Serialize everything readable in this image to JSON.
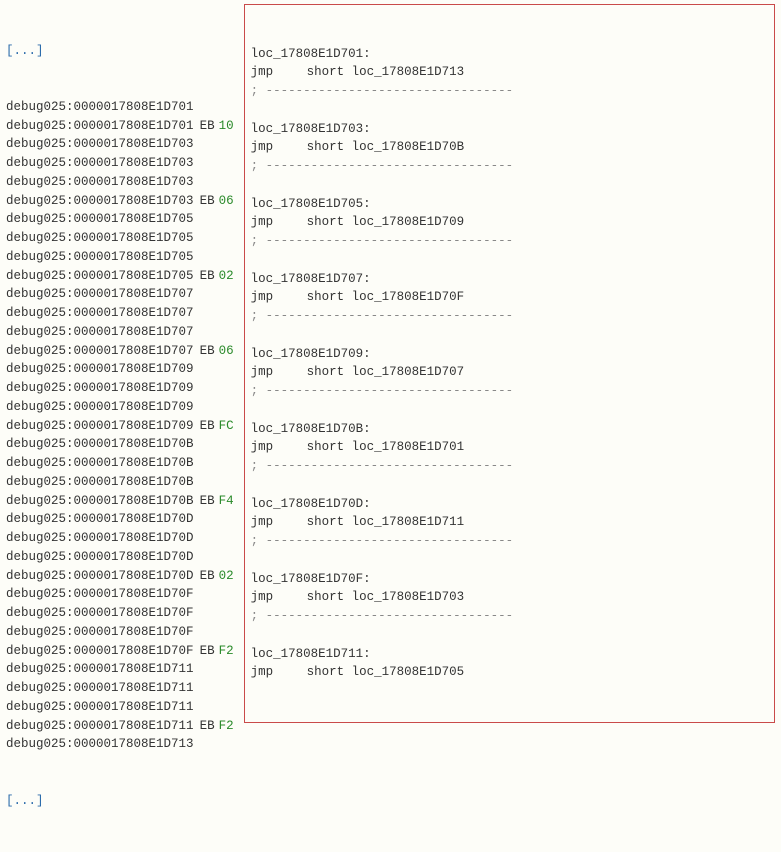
{
  "ellipsis_top": "[...]",
  "ellipsis_bottom": "[...]",
  "segment": "debug025",
  "left_lines": [
    {
      "addr": "0000017808E1D701",
      "bytes": []
    },
    {
      "addr": "0000017808E1D701",
      "bytes": [
        "EB",
        "10"
      ]
    },
    {
      "addr": "0000017808E1D703",
      "bytes": []
    },
    {
      "addr": "0000017808E1D703",
      "bytes": []
    },
    {
      "addr": "0000017808E1D703",
      "bytes": []
    },
    {
      "addr": "0000017808E1D703",
      "bytes": [
        "EB",
        "06"
      ]
    },
    {
      "addr": "0000017808E1D705",
      "bytes": []
    },
    {
      "addr": "0000017808E1D705",
      "bytes": []
    },
    {
      "addr": "0000017808E1D705",
      "bytes": []
    },
    {
      "addr": "0000017808E1D705",
      "bytes": [
        "EB",
        "02"
      ]
    },
    {
      "addr": "0000017808E1D707",
      "bytes": []
    },
    {
      "addr": "0000017808E1D707",
      "bytes": []
    },
    {
      "addr": "0000017808E1D707",
      "bytes": []
    },
    {
      "addr": "0000017808E1D707",
      "bytes": [
        "EB",
        "06"
      ]
    },
    {
      "addr": "0000017808E1D709",
      "bytes": []
    },
    {
      "addr": "0000017808E1D709",
      "bytes": []
    },
    {
      "addr": "0000017808E1D709",
      "bytes": []
    },
    {
      "addr": "0000017808E1D709",
      "bytes": [
        "EB",
        "FC"
      ]
    },
    {
      "addr": "0000017808E1D70B",
      "bytes": []
    },
    {
      "addr": "0000017808E1D70B",
      "bytes": []
    },
    {
      "addr": "0000017808E1D70B",
      "bytes": []
    },
    {
      "addr": "0000017808E1D70B",
      "bytes": [
        "EB",
        "F4"
      ]
    },
    {
      "addr": "0000017808E1D70D",
      "bytes": []
    },
    {
      "addr": "0000017808E1D70D",
      "bytes": []
    },
    {
      "addr": "0000017808E1D70D",
      "bytes": []
    },
    {
      "addr": "0000017808E1D70D",
      "bytes": [
        "EB",
        "02"
      ]
    },
    {
      "addr": "0000017808E1D70F",
      "bytes": []
    },
    {
      "addr": "0000017808E1D70F",
      "bytes": []
    },
    {
      "addr": "0000017808E1D70F",
      "bytes": []
    },
    {
      "addr": "0000017808E1D70F",
      "bytes": [
        "EB",
        "F2"
      ]
    },
    {
      "addr": "0000017808E1D711",
      "bytes": []
    },
    {
      "addr": "0000017808E1D711",
      "bytes": []
    },
    {
      "addr": "0000017808E1D711",
      "bytes": []
    },
    {
      "addr": "0000017808E1D711",
      "bytes": [
        "EB",
        "F2"
      ]
    },
    {
      "addr": "0000017808E1D713",
      "bytes": []
    }
  ],
  "right_blocks": [
    {
      "label": "loc_17808E1D701:",
      "instr": "jmp",
      "args": "short loc_17808E1D713",
      "dash": true
    },
    {
      "label": "loc_17808E1D703:",
      "instr": "jmp",
      "args": "short loc_17808E1D70B",
      "dash": true
    },
    {
      "label": "loc_17808E1D705:",
      "instr": "jmp",
      "args": "short loc_17808E1D709",
      "dash": true
    },
    {
      "label": "loc_17808E1D707:",
      "instr": "jmp",
      "args": "short loc_17808E1D70F",
      "dash": true
    },
    {
      "label": "loc_17808E1D709:",
      "instr": "jmp",
      "args": "short loc_17808E1D707",
      "dash": true
    },
    {
      "label": "loc_17808E1D70B:",
      "instr": "jmp",
      "args": "short loc_17808E1D701",
      "dash": true
    },
    {
      "label": "loc_17808E1D70D:",
      "instr": "jmp",
      "args": "short loc_17808E1D711",
      "dash": true
    },
    {
      "label": "loc_17808E1D70F:",
      "instr": "jmp",
      "args": "short loc_17808E1D703",
      "dash": true
    },
    {
      "label": "loc_17808E1D711:",
      "instr": "jmp",
      "args": "short loc_17808E1D705",
      "dash": false
    }
  ],
  "dash_line": "; ---------------------------------"
}
